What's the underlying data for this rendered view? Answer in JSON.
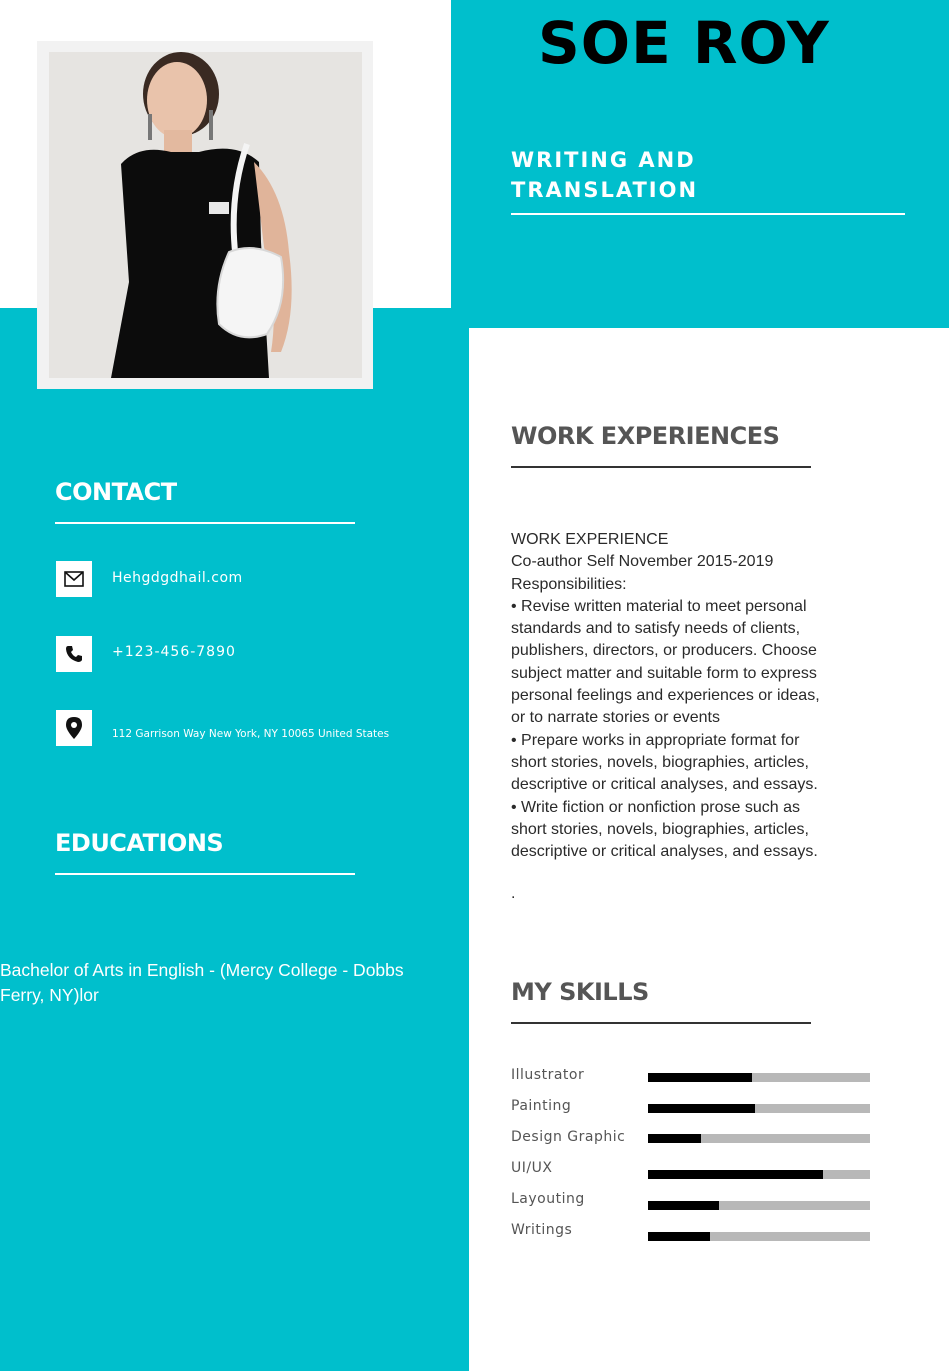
{
  "header": {
    "name": "SOE ROY",
    "role_line1": "WRITING AND",
    "role_line2": "TRANSLATION"
  },
  "contact": {
    "heading": "CONTACT",
    "email": "Hehgdgdhail.com",
    "phone": "+123-456-7890",
    "address": "112 Garrison Way New York, NY 10065 United States",
    "icons": [
      "mail-icon",
      "phone-icon",
      "location-pin-icon"
    ]
  },
  "education": {
    "heading": "EDUCATIONS",
    "line1": "Bachelor of Arts in English - (Mercy College - Dobbs",
    "line2": "Ferry, NY)lor"
  },
  "work": {
    "heading": "WORK EXPERIENCES",
    "lines": [
      "WORK EXPERIENCE",
      "Co-author Self November 2015-2019",
      "Responsibilities:",
      "• Revise written material to meet personal",
      "standards and to satisfy needs of clients,",
      "publishers, directors, or producers. Choose",
      "subject matter and suitable form to express",
      "personal feelings and experiences or ideas,",
      "or to narrate stories or events",
      "• Prepare works in appropriate format for",
      "short stories, novels, biographies, articles,",
      "descriptive or critical analyses, and essays.",
      "• Write fiction or nonfiction prose such as",
      "short stories, novels, biographies, articles,",
      "descriptive or critical analyses, and essays."
    ],
    "trailing_dot": "."
  },
  "skills": {
    "heading": "MY SKILLS",
    "items": [
      {
        "label": "Illustrator",
        "level": 0.47
      },
      {
        "label": "Painting",
        "level": 0.48
      },
      {
        "label": "Design Graphic",
        "level": 0.24
      },
      {
        "label": "UI/UX",
        "level": 0.79
      },
      {
        "label": "Layouting",
        "level": 0.32
      },
      {
        "label": "Writings",
        "level": 0.28
      }
    ]
  },
  "colors": {
    "accent": "#00bfcc",
    "skill_fill": "#000000",
    "skill_track": "#b8b8b8"
  }
}
